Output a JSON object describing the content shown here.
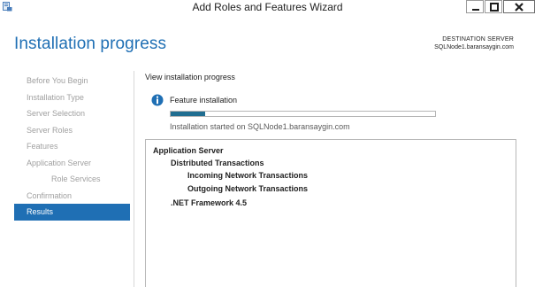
{
  "window": {
    "title": "Add Roles and Features Wizard"
  },
  "header": {
    "title": "Installation progress",
    "destination_label": "DESTINATION SERVER",
    "destination_value": "SQLNode1.baransaygin.com"
  },
  "nav": {
    "items": [
      {
        "label": "Before You Begin",
        "state": "disabled"
      },
      {
        "label": "Installation Type",
        "state": "disabled"
      },
      {
        "label": "Server Selection",
        "state": "disabled"
      },
      {
        "label": "Server Roles",
        "state": "disabled"
      },
      {
        "label": "Features",
        "state": "disabled"
      },
      {
        "label": "Application Server",
        "state": "disabled"
      },
      {
        "label": "Role Services",
        "state": "disabled"
      },
      {
        "label": "Confirmation",
        "state": "disabled"
      },
      {
        "label": "Results",
        "state": "active"
      }
    ]
  },
  "main": {
    "heading": "View installation progress",
    "feature_title": "Feature installation",
    "progress_percent": 13,
    "status_text": "Installation started on SQLNode1.baransaygin.com",
    "results": [
      {
        "label": "Application Server",
        "level": 0
      },
      {
        "label": "Distributed Transactions",
        "level": 1
      },
      {
        "label": "Incoming Network Transactions",
        "level": 2
      },
      {
        "label": "Outgoing Network Transactions",
        "level": 2
      },
      {
        "label": ".NET Framework 4.5",
        "level": 1
      }
    ]
  },
  "colors": {
    "accent": "#1f6fb4",
    "progress_fill": "#206e91",
    "nav_disabled_text": "#a0a0a0"
  },
  "icons": {
    "app": "server-manager-icon",
    "info": "info-icon"
  }
}
